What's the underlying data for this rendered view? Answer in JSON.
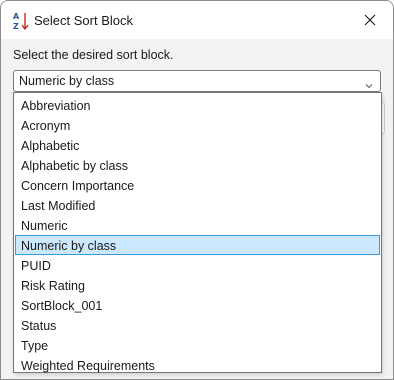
{
  "window": {
    "title": "Select Sort Block",
    "icon": "sort-az-icon",
    "close_icon": "close-icon"
  },
  "prompt": "Select the desired sort block.",
  "combo": {
    "selected": "Numeric by class",
    "arrow_icon": "chevron-down-icon"
  },
  "dropdown": {
    "items": [
      "Abbreviation",
      "Acronym",
      "Alphabetic",
      "Alphabetic by class",
      "Concern Importance",
      "Last Modified",
      "Numeric",
      "Numeric by class",
      "PUID",
      "Risk Rating",
      "SortBlock_001",
      "Status",
      "Type",
      "Weighted Requirements"
    ],
    "highlighted": "Numeric by class"
  },
  "colors": {
    "highlight_bg": "#cce8ff",
    "highlight_border": "#3c99dc",
    "icon_blue": "#2b5797",
    "icon_red": "#c42b1c"
  }
}
